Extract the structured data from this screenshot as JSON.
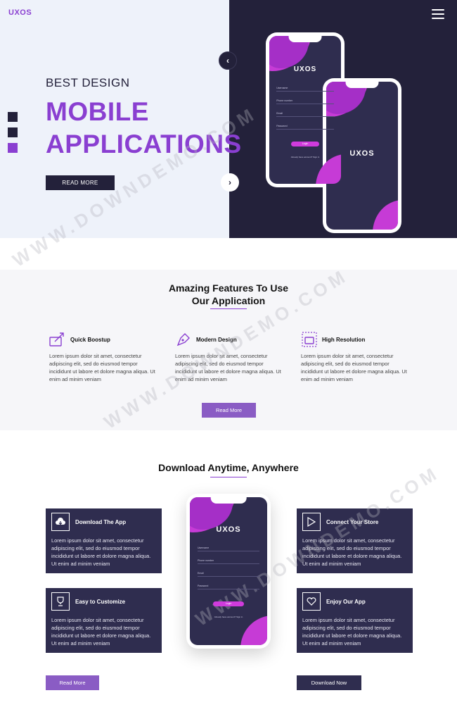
{
  "header": {
    "logo": "UXOS"
  },
  "hero": {
    "pre_title": "BEST DESIGN",
    "title_line1": "MOBILE",
    "title_line2": "APPLICATIONS",
    "button": "READ MORE"
  },
  "phone": {
    "logo": "UXOS",
    "fields": [
      "Username",
      "Phone number",
      "Email",
      "Password"
    ],
    "login": "Login",
    "foot": "Already have account? Sign in"
  },
  "features": {
    "title_line1": "Amazing Features To Use",
    "title_line2": "Our Application",
    "items": [
      {
        "name": "Quick Boostup",
        "text": "Lorem ipsum dolor sit amet, consectetur adipiscing elit, sed do eiusmod tempor incididunt ut labore et dolore magna aliqua. Ut enim ad minim veniam"
      },
      {
        "name": "Modern Design",
        "text": "Lorem ipsum dolor sit amet, consectetur adipiscing elit, sed do eiusmod tempor incididunt ut labore et dolore magna aliqua. Ut enim ad minim veniam"
      },
      {
        "name": "High Resolution",
        "text": "Lorem ipsum dolor sit amet, consectetur adipiscing elit, sed do eiusmod tempor incididunt ut labore et dolore magna aliqua. Ut enim ad minim veniam"
      }
    ],
    "button": "Read More"
  },
  "download": {
    "title": "Download Anytime, Anywhere",
    "cards": [
      {
        "name": "Download The App",
        "text": "Lorem ipsum dolor sit amet, consectetur adipiscing elit, sed do eiusmod tempor incididunt ut labore et dolore magna aliqua. Ut enim ad minim veniam"
      },
      {
        "name": "Connect Your Store",
        "text": "Lorem ipsum dolor sit amet, consectetur adipiscing elit, sed do eiusmod tempor incididunt ut labore et dolore magna aliqua. Ut enim ad minim veniam"
      },
      {
        "name": "Easy to Customize",
        "text": "Lorem ipsum dolor sit amet, consectetur adipiscing elit, sed do eiusmod tempor incididunt ut labore et dolore magna aliqua. Ut enim ad minim veniam"
      },
      {
        "name": "Enjoy Our App",
        "text": "Lorem ipsum dolor sit amet, consectetur adipiscing elit, sed do eiusmod tempor incididunt ut labore et dolore magna aliqua. Ut enim ad minim veniam"
      }
    ],
    "read_more": "Read More",
    "download_now": "Download Now"
  },
  "watermark": "WWW.DOWNDEMO.COM",
  "colors": {
    "accent": "#8a3fd1",
    "dark": "#23213a",
    "card": "#2f2d4f",
    "hero_light": "#eef2fa",
    "pink": "#c63bd6"
  }
}
